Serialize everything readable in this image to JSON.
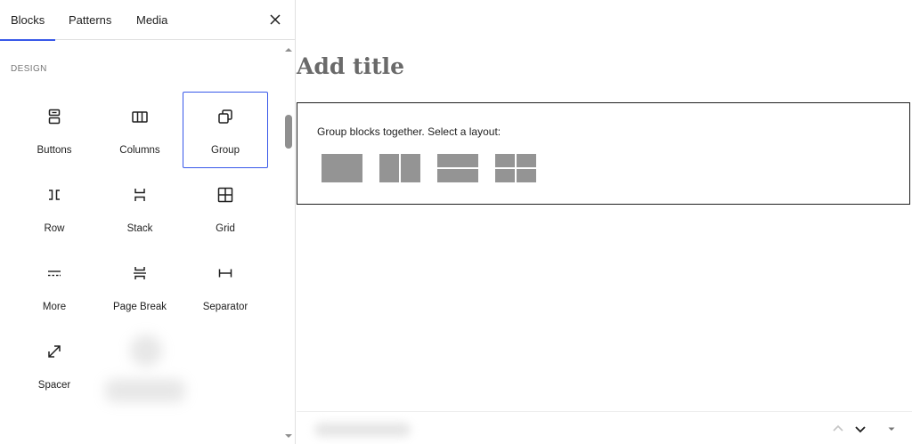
{
  "sidebar": {
    "tabs": [
      {
        "label": "Blocks",
        "active": true
      },
      {
        "label": "Patterns",
        "active": false
      },
      {
        "label": "Media",
        "active": false
      }
    ],
    "close_icon": "close-icon",
    "section_label": "DESIGN",
    "blocks": [
      {
        "label": "Buttons",
        "icon": "buttons-icon"
      },
      {
        "label": "Columns",
        "icon": "columns-icon"
      },
      {
        "label": "Group",
        "icon": "group-icon",
        "selected": true
      },
      {
        "label": "Row",
        "icon": "row-icon"
      },
      {
        "label": "Stack",
        "icon": "stack-icon"
      },
      {
        "label": "Grid",
        "icon": "grid-icon"
      },
      {
        "label": "More",
        "icon": "more-icon"
      },
      {
        "label": "Page Break",
        "icon": "page-break-icon"
      },
      {
        "label": "Separator",
        "icon": "separator-icon"
      },
      {
        "label": "Spacer",
        "icon": "spacer-icon"
      }
    ]
  },
  "canvas": {
    "title_placeholder": "Add title",
    "group_placeholder": {
      "instructions": "Group blocks together. Select a layout:",
      "layouts": [
        "group",
        "row",
        "stack",
        "grid"
      ]
    }
  },
  "colors": {
    "accent": "#3858e9",
    "layout_fill": "#949494",
    "title": "#6a6a6a"
  }
}
